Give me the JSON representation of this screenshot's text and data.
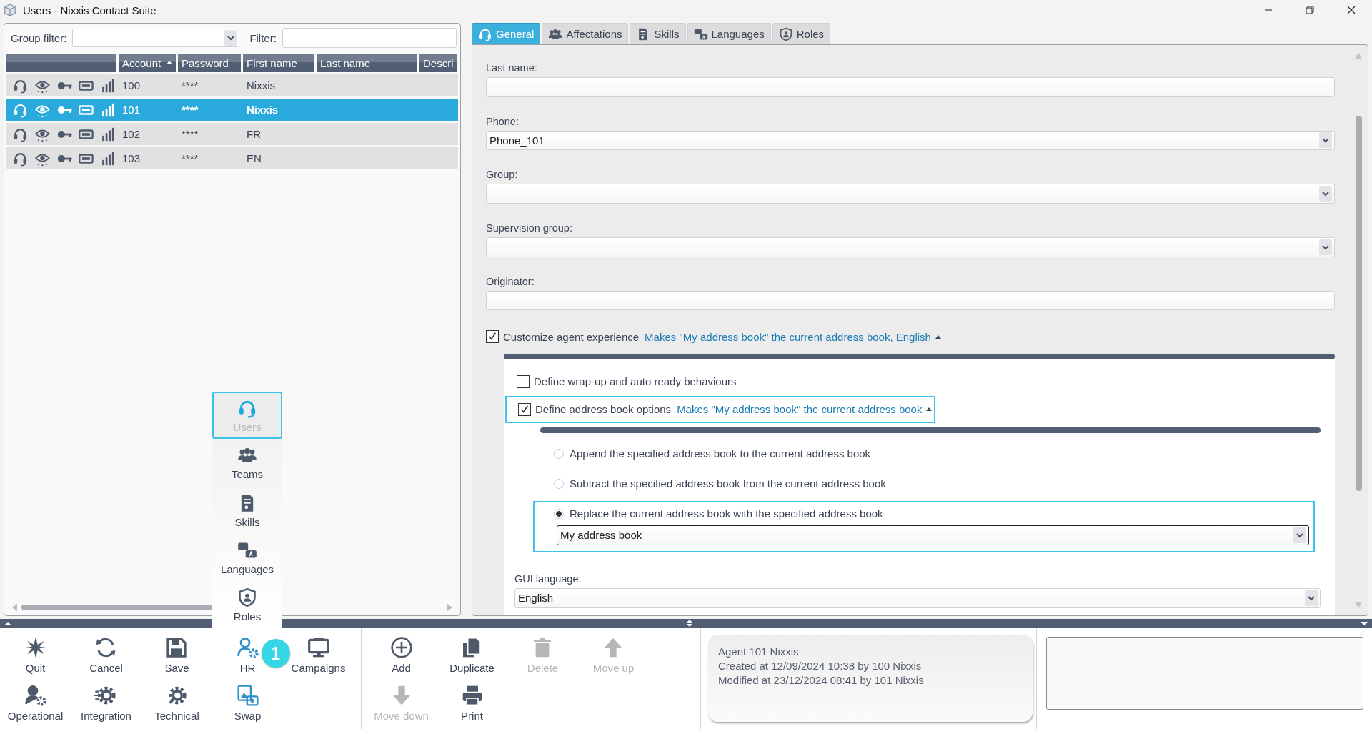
{
  "window": {
    "title": "Users - Nixxis Contact Suite"
  },
  "user_list": {
    "group_filter": {
      "label": "Group filter:"
    },
    "filter": {
      "label": "Filter:"
    },
    "columns": [
      {
        "label": "Account",
        "sorted": true
      },
      {
        "label": "Password",
        "sorted": false
      },
      {
        "label": "First name",
        "sorted": false
      },
      {
        "label": "Last name",
        "sorted": false
      },
      {
        "label": "Descri",
        "sorted": false
      }
    ],
    "rows": [
      {
        "account": "100",
        "password": "****",
        "first_name": "Nixxis",
        "selected": false
      },
      {
        "account": "101",
        "password": "****",
        "first_name": "Nixxis",
        "selected": true
      },
      {
        "account": "102",
        "password": "****",
        "first_name": "FR",
        "selected": false
      },
      {
        "account": "103",
        "password": "****",
        "first_name": "EN",
        "selected": false
      }
    ]
  },
  "nav_menu": {
    "items": [
      {
        "label": "Users",
        "kind": "headset",
        "selected": true
      },
      {
        "label": "Teams",
        "kind": "people",
        "selected": false
      },
      {
        "label": "Skills",
        "kind": "document",
        "selected": false
      },
      {
        "label": "Languages",
        "kind": "languages",
        "selected": false
      },
      {
        "label": "Roles",
        "kind": "shield",
        "selected": false
      }
    ]
  },
  "tabs": [
    {
      "label": "General",
      "kind": "headset",
      "selected": true
    },
    {
      "label": "Affectations",
      "kind": "people",
      "selected": false
    },
    {
      "label": "Skills",
      "kind": "document",
      "selected": false
    },
    {
      "label": "Languages",
      "kind": "languages",
      "selected": false
    },
    {
      "label": "Roles",
      "kind": "shield",
      "selected": false
    }
  ],
  "form": {
    "fields": [
      {
        "label": "Last name:",
        "kind": "text"
      },
      {
        "label": "Phone:",
        "kind": "select",
        "value": "Phone_101"
      },
      {
        "label": "Group:",
        "kind": "select"
      },
      {
        "label": "Supervision group:",
        "kind": "select"
      },
      {
        "label": "Originator:",
        "kind": "text"
      }
    ],
    "customize": {
      "label": "Customize agent experience",
      "checked": true,
      "summary": "Makes \"My address book\" the current address book, English",
      "expanded": true,
      "options": [
        {
          "label": "Define wrap-up and auto ready behaviours",
          "checked": false,
          "focused": false
        },
        {
          "label": "Define address book options",
          "checked": true,
          "focused": true,
          "summary": "Makes \"My address book\" the current address book",
          "expanded": true,
          "address_book": {
            "choices": [
              {
                "label": "Append the specified address book to the current address book",
                "selected": false
              },
              {
                "label": "Subtract the specified address book from the current address book",
                "selected": false
              },
              {
                "label": "Replace the current address book with the specified address book",
                "selected": true
              }
            ],
            "book": "My address book"
          }
        }
      ],
      "gui_language": {
        "label": "GUI language:",
        "value": "English"
      }
    }
  },
  "toolbar": {
    "groups": [
      {
        "buttons": [
          {
            "label": "Quit",
            "kind": "quit",
            "disabled": false
          },
          {
            "label": "Cancel",
            "kind": "cancel",
            "disabled": false
          },
          {
            "label": "Save",
            "kind": "save",
            "disabled": false
          },
          {
            "label": "HR",
            "kind": "hr",
            "disabled": false,
            "badge": "1"
          },
          {
            "label": "Campaigns",
            "kind": "campaigns",
            "disabled": false
          },
          {
            "label": "Operational",
            "kind": "operational",
            "disabled": false
          },
          {
            "label": "Integration",
            "kind": "integration",
            "disabled": false
          },
          {
            "label": "Technical",
            "kind": "technical",
            "disabled": false
          },
          {
            "label": "Swap",
            "kind": "swap",
            "disabled": false
          }
        ]
      },
      {
        "buttons": [
          {
            "label": "Add",
            "kind": "add",
            "disabled": false
          },
          {
            "label": "Duplicate",
            "kind": "duplicate",
            "disabled": false
          },
          {
            "label": "Delete",
            "kind": "delete",
            "disabled": true
          },
          {
            "label": "Move up",
            "kind": "moveup",
            "disabled": true
          },
          {
            "label": "Move down",
            "kind": "movedown",
            "disabled": true
          },
          {
            "label": "Print",
            "kind": "print",
            "disabled": false
          }
        ]
      }
    ]
  },
  "record_info": {
    "lines": [
      "Agent 101 Nixxis",
      "Created at 12/09/2024 10:38 by 100 Nixxis",
      "Modified at 23/12/2024 08:41 by 101 Nixxis"
    ]
  }
}
